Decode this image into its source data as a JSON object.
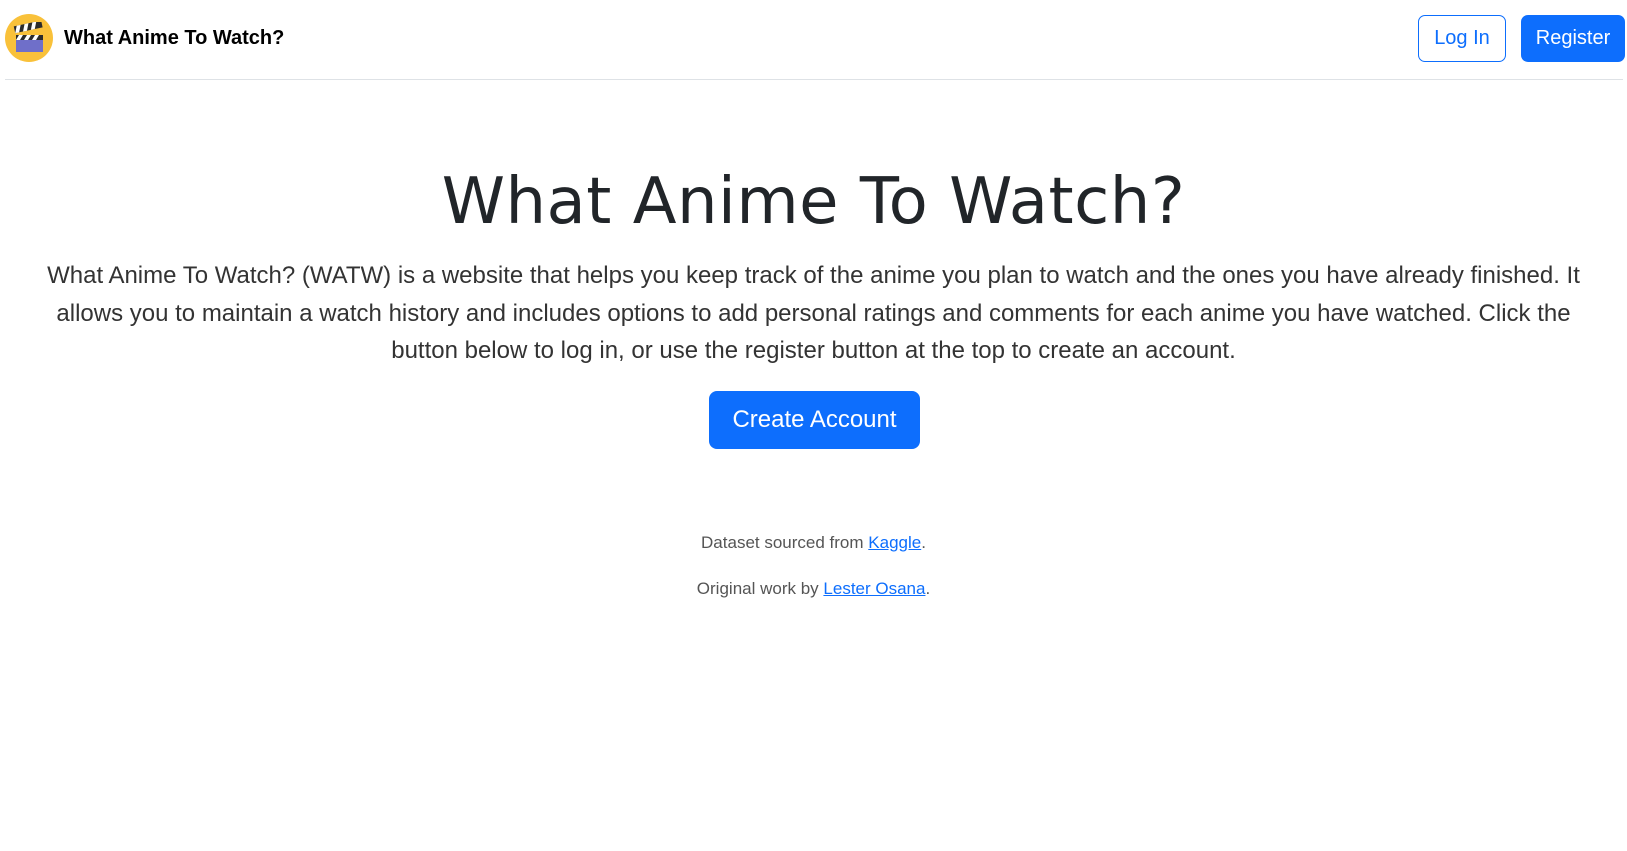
{
  "navbar": {
    "brand_logo_icon": "clapperboard-icon",
    "brand_text": "What Anime To Watch?",
    "login_label": "Log In",
    "register_label": "Register"
  },
  "hero": {
    "title": "What Anime To Watch?",
    "lead": "What Anime To Watch? (WATW) is a website that helps you keep track of the anime you plan to watch and the ones you have already finished. It allows you to maintain a watch history and includes options to add personal ratings and comments for each anime you have watched. Click the button below to log in, or use the register button at the top to create an account.",
    "create_account_label": "Create Account"
  },
  "footer": {
    "dataset_prefix": "Dataset sourced from ",
    "dataset_link": "Kaggle",
    "dataset_suffix": ".",
    "author_prefix": "Original work by ",
    "author_link": "Lester Osana",
    "author_suffix": "."
  },
  "colors": {
    "primary": "#0d6efd",
    "logo_bg": "#f9c13a",
    "text": "#212529"
  }
}
